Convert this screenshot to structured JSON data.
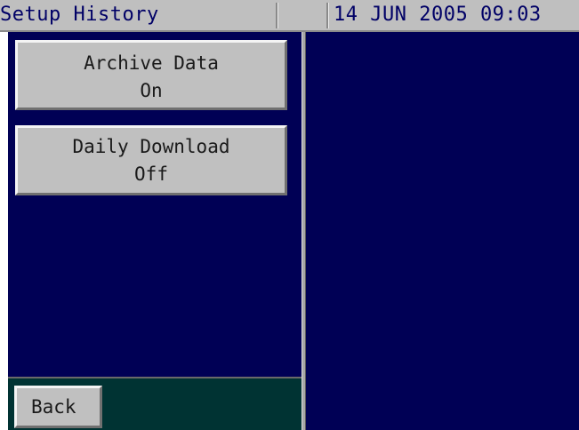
{
  "header": {
    "title": "Setup History",
    "datetime": "14 JUN 2005 09:03"
  },
  "buttons": {
    "archive": {
      "label": "Archive Data",
      "value": "On"
    },
    "daily_download": {
      "label": "Daily Download",
      "value": "Off"
    },
    "back": {
      "label": "Back"
    }
  },
  "colors": {
    "panel_background": "#000055",
    "bottom_bar": "#003333",
    "title_bar": "#bfbfbf",
    "button_face": "#c0c0c0"
  }
}
